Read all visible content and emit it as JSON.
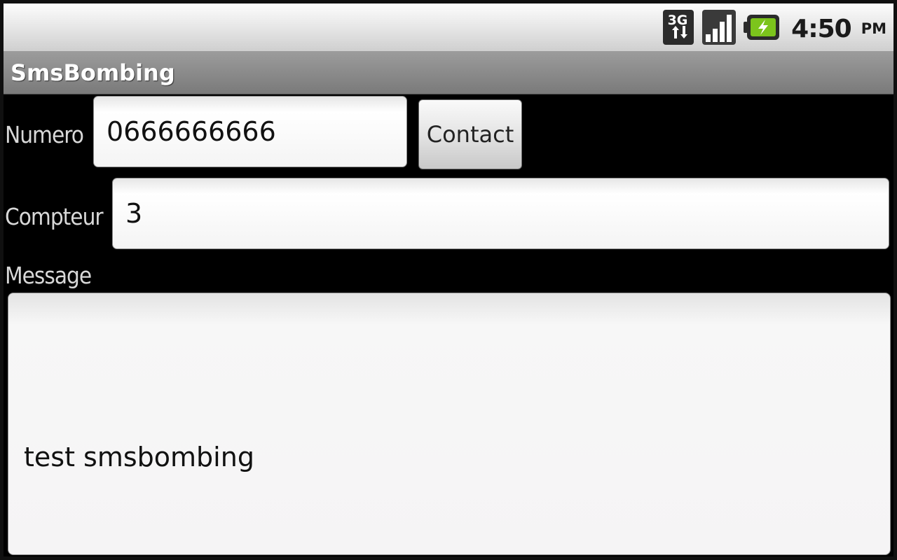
{
  "status_bar": {
    "network_icon": "3g-data-icon",
    "network_label": "3G",
    "signal_icon": "signal-strength-icon",
    "battery_icon": "battery-charging-icon",
    "time": "4:50",
    "ampm": "PM",
    "colors": {
      "battery": "#7cc41c"
    }
  },
  "app": {
    "title": "SmsBombing"
  },
  "form": {
    "numero_label": "Numero",
    "numero_value": "0666666666",
    "contact_button": "Contact",
    "compteur_label": "Compteur",
    "compteur_value": "3",
    "message_label": "Message",
    "message_value": "test smsbombing"
  }
}
